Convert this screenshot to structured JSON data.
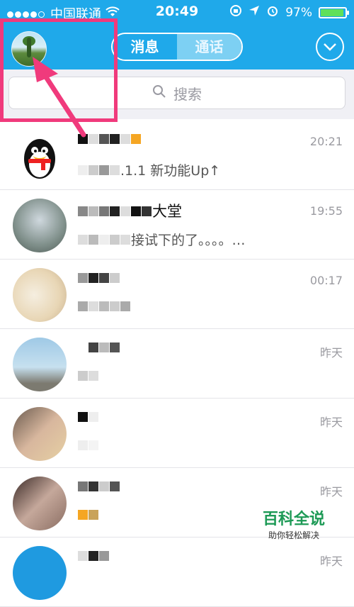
{
  "status": {
    "carrier": "中国联通",
    "time": "20:49",
    "battery": "97%",
    "battery_level": 0.97
  },
  "nav": {
    "tab_messages": "消息",
    "tab_calls": "通话",
    "active_tab": "消息"
  },
  "search": {
    "placeholder": "搜索"
  },
  "conversations": [
    {
      "name": "QQ团队",
      "message": ".1.1 新功能Up↑",
      "time": "20:21"
    },
    {
      "name": "大堂",
      "message": "接试下的了。。。。…",
      "time": "19:55"
    },
    {
      "name": "",
      "message": "",
      "time": "00:17"
    },
    {
      "name": "",
      "message": "",
      "time": "昨天"
    },
    {
      "name": "",
      "message": "",
      "time": "昨天"
    },
    {
      "name": "",
      "message": "",
      "time": "昨天"
    },
    {
      "name": "",
      "message": "",
      "time": "昨天"
    }
  ],
  "watermark": {
    "title": "百科全说",
    "subtitle": "助你轻松解决"
  },
  "colors": {
    "header_blue": "#1fa9ea",
    "annotation_pink": "#f03a7c",
    "watermark_green": "#1d9a56"
  },
  "icons": [
    "signal-icon",
    "wifi-icon",
    "rotation-lock-icon",
    "location-icon",
    "alarm-icon",
    "battery-icon",
    "search-icon",
    "chevron-down-icon"
  ]
}
